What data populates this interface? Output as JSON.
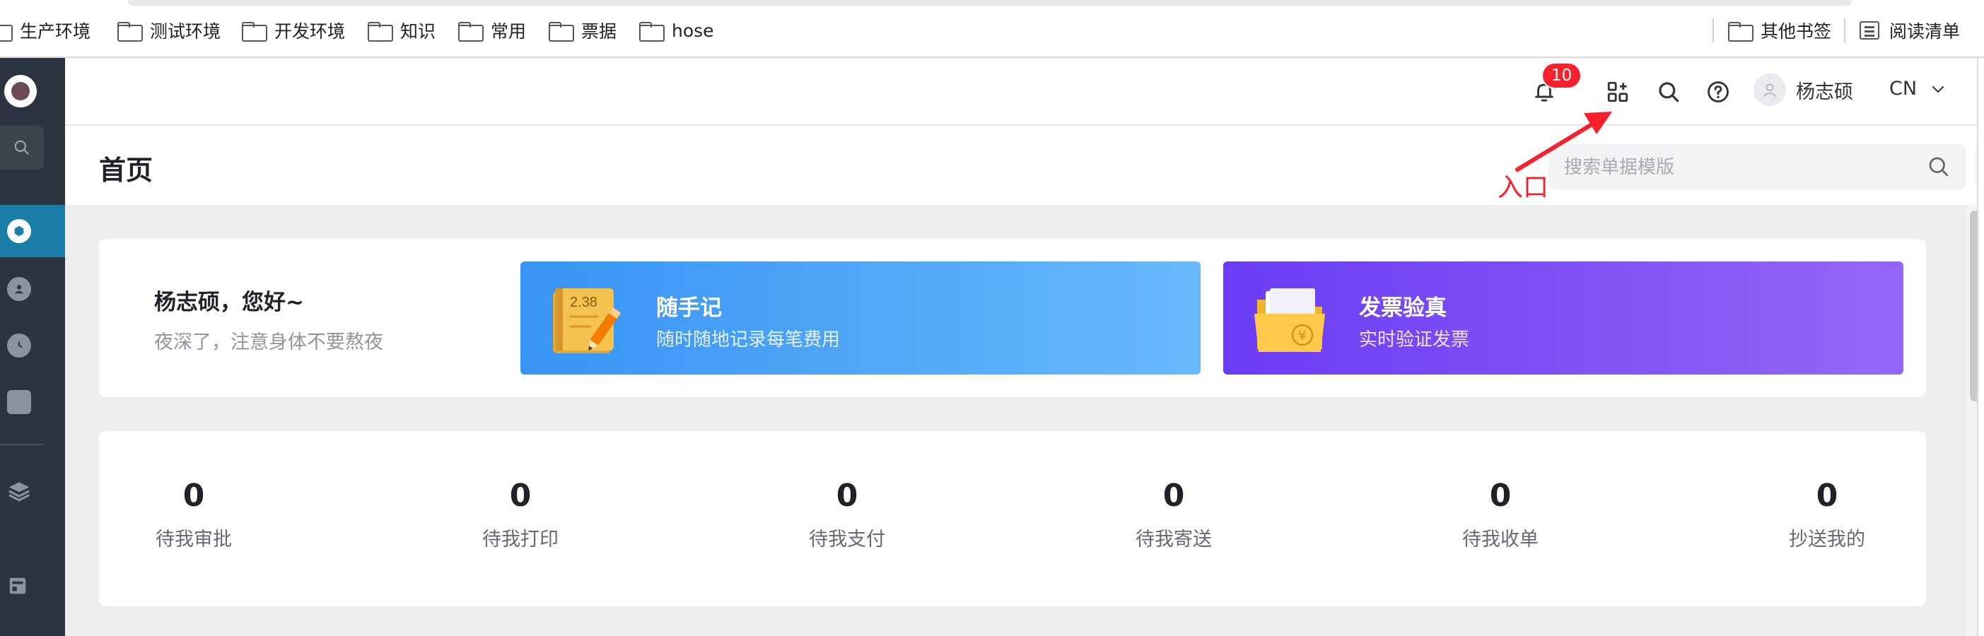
{
  "bookmarks": {
    "items": [
      "生产环境",
      "测试环境",
      "开发环境",
      "知识",
      "常用",
      "票据",
      "hose"
    ],
    "other_label": "其他书签",
    "reading_label": "阅读清单"
  },
  "header": {
    "notification_count": "10",
    "user_name": "杨志硕",
    "language": "CN"
  },
  "page": {
    "title": "首页",
    "search_placeholder": "搜索单据模版"
  },
  "annotation": {
    "label": "入口",
    "color": "#f5222d"
  },
  "welcome": {
    "name_line": "杨志硕，您好~",
    "subtitle": "夜深了，注意身体不要熬夜"
  },
  "promos": [
    {
      "title": "随手记",
      "subtitle": "随时随地记录每笔费用",
      "icon_text": "2.38"
    },
    {
      "title": "发票验真",
      "subtitle": "实时验证发票",
      "icon_text": "¥"
    }
  ],
  "stats": [
    {
      "value": "0",
      "label": "待我审批"
    },
    {
      "value": "0",
      "label": "待我打印"
    },
    {
      "value": "0",
      "label": "待我支付"
    },
    {
      "value": "0",
      "label": "待我寄送"
    },
    {
      "value": "0",
      "label": "待我收单"
    },
    {
      "value": "0",
      "label": "抄送我的"
    }
  ],
  "colors": {
    "nav_bg": "#2b3440",
    "nav_active": "#1a7fa8",
    "badge": "#f5222d",
    "promo_blue": "#3794f4",
    "promo_purple": "#6a3df5"
  }
}
